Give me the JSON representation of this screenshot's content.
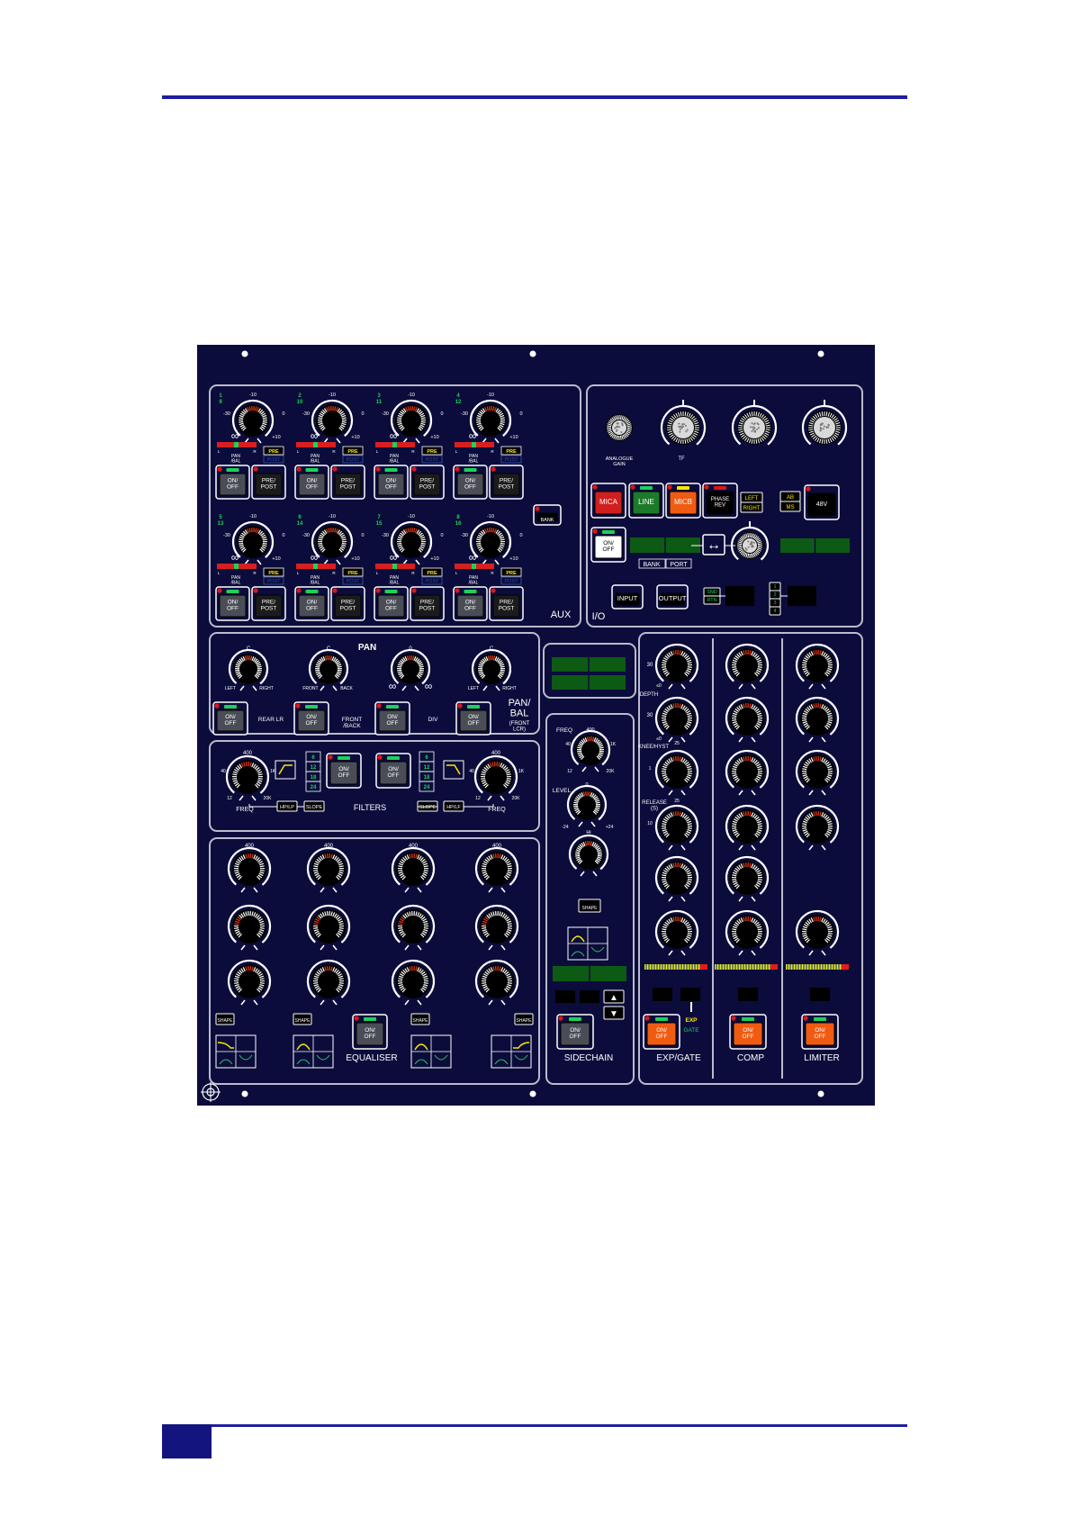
{
  "colors": {
    "panel": "#0b0c3b",
    "frame": "#b9bccb",
    "page_rule": "#1f1f9e",
    "led": "#e01515",
    "green": "#1fd05a",
    "display": "#0d5a14",
    "red_btn": "#d11f1f",
    "orange_btn": "#f05b12",
    "green_btn": "#1d7a2a"
  },
  "aux": {
    "section_label": "AUX",
    "bank_label": "BANK",
    "channels": [
      [
        "1",
        "9"
      ],
      [
        "2",
        "10"
      ],
      [
        "3",
        "11"
      ],
      [
        "4",
        "12"
      ],
      [
        "5",
        "13"
      ],
      [
        "6",
        "14"
      ],
      [
        "7",
        "15"
      ],
      [
        "8",
        "16"
      ]
    ],
    "scale": {
      "top": "-10",
      "left": "-30",
      "right": "0",
      "bottom_right": "+10",
      "bottom_left": "∞"
    },
    "pan_label": "PAN\n/BAL",
    "pan_l": "L",
    "pan_r": "R",
    "pre": "PRE",
    "post": "POST",
    "on_off": "ON/\nOFF",
    "pre_post": "PRE/\nPOST"
  },
  "io": {
    "section_label": "I/O",
    "analogue_gain": "ANALOGUE\nGAIN",
    "tf": "TF",
    "mica": "MICA",
    "line": "LINE",
    "micb": "MICB",
    "phase_rev": "PHASE\nREV",
    "left": "LEFT",
    "right": "RIGHT",
    "ab": "AB",
    "ms": "MS",
    "v48": "48V",
    "on_off": "ON/\nOFF",
    "bank": "BANK",
    "port": "PORT",
    "input": "INPUT",
    "output": "OUTPUT",
    "snd": "SND",
    "rtn": "RTN",
    "ports": [
      "1",
      "2",
      "3",
      "4"
    ]
  },
  "pan": {
    "section_label": "PAN",
    "knobs": [
      {
        "top": "C",
        "l": "LEFT",
        "r": "RIGHT"
      },
      {
        "top": "C",
        "l": "FRONT",
        "r": "BACK"
      },
      {
        "top": "0",
        "l": "∞",
        "r": "∞"
      },
      {
        "top": "C",
        "l": "LEFT",
        "r": "RIGHT"
      }
    ],
    "buttons": [
      "REAR LR",
      "FRONT\n/BACK",
      "DIV",
      ""
    ],
    "panbal": "PAN/\nBAL",
    "panbal_sub": "(FRONT\nLCR)",
    "on_off": "ON/\nOFF"
  },
  "filters": {
    "section_label": "FILTERS",
    "freq": "FREQ",
    "top": "400",
    "left": "40",
    "right": "1K",
    "bl": "12",
    "br": "20K",
    "hplp": "HP/LP",
    "slope": "SLOPE",
    "hplf": "HP/LF",
    "slopes": [
      "6",
      "12",
      "18",
      "24"
    ],
    "on_off": "ON/\nOFF"
  },
  "eq": {
    "section_label": "EQUALISER",
    "shape": "SHAPE",
    "on_off": "ON/\nOFF",
    "band_top": [
      "400",
      "400",
      "400",
      "400"
    ]
  },
  "sidechain": {
    "section_label": "SIDECHAIN",
    "freq": "FREQ",
    "level": "LEVEL",
    "freq_top": "400",
    "freq_l": "40",
    "freq_r": "1K",
    "freq_bl": "12",
    "freq_br": "20K",
    "lvl_top": "0",
    "lvl_bl": "-24",
    "lvl_br": "+24",
    "q_top": "Hi",
    "shape": "SHAPE",
    "on_off": "ON/\nOFF",
    "up": "▲",
    "down": "▼"
  },
  "dynamics": {
    "exp_label": "EXP/GATE",
    "comp_label": "COMP",
    "lim_label": "LIMITER",
    "depth": "DEPTH",
    "knee": "KNEE/HYST",
    "release": "RELEASE\n(S)",
    "s30a": "30",
    "s30b": "30",
    "s25a": "25",
    "s25b": "25",
    "s50a": "≤0",
    "s50b": "≤0",
    "s1": "1",
    "s10": "10",
    "exp": "EXP",
    "gate": "GATE",
    "on_off": "ON/\nOFF"
  }
}
